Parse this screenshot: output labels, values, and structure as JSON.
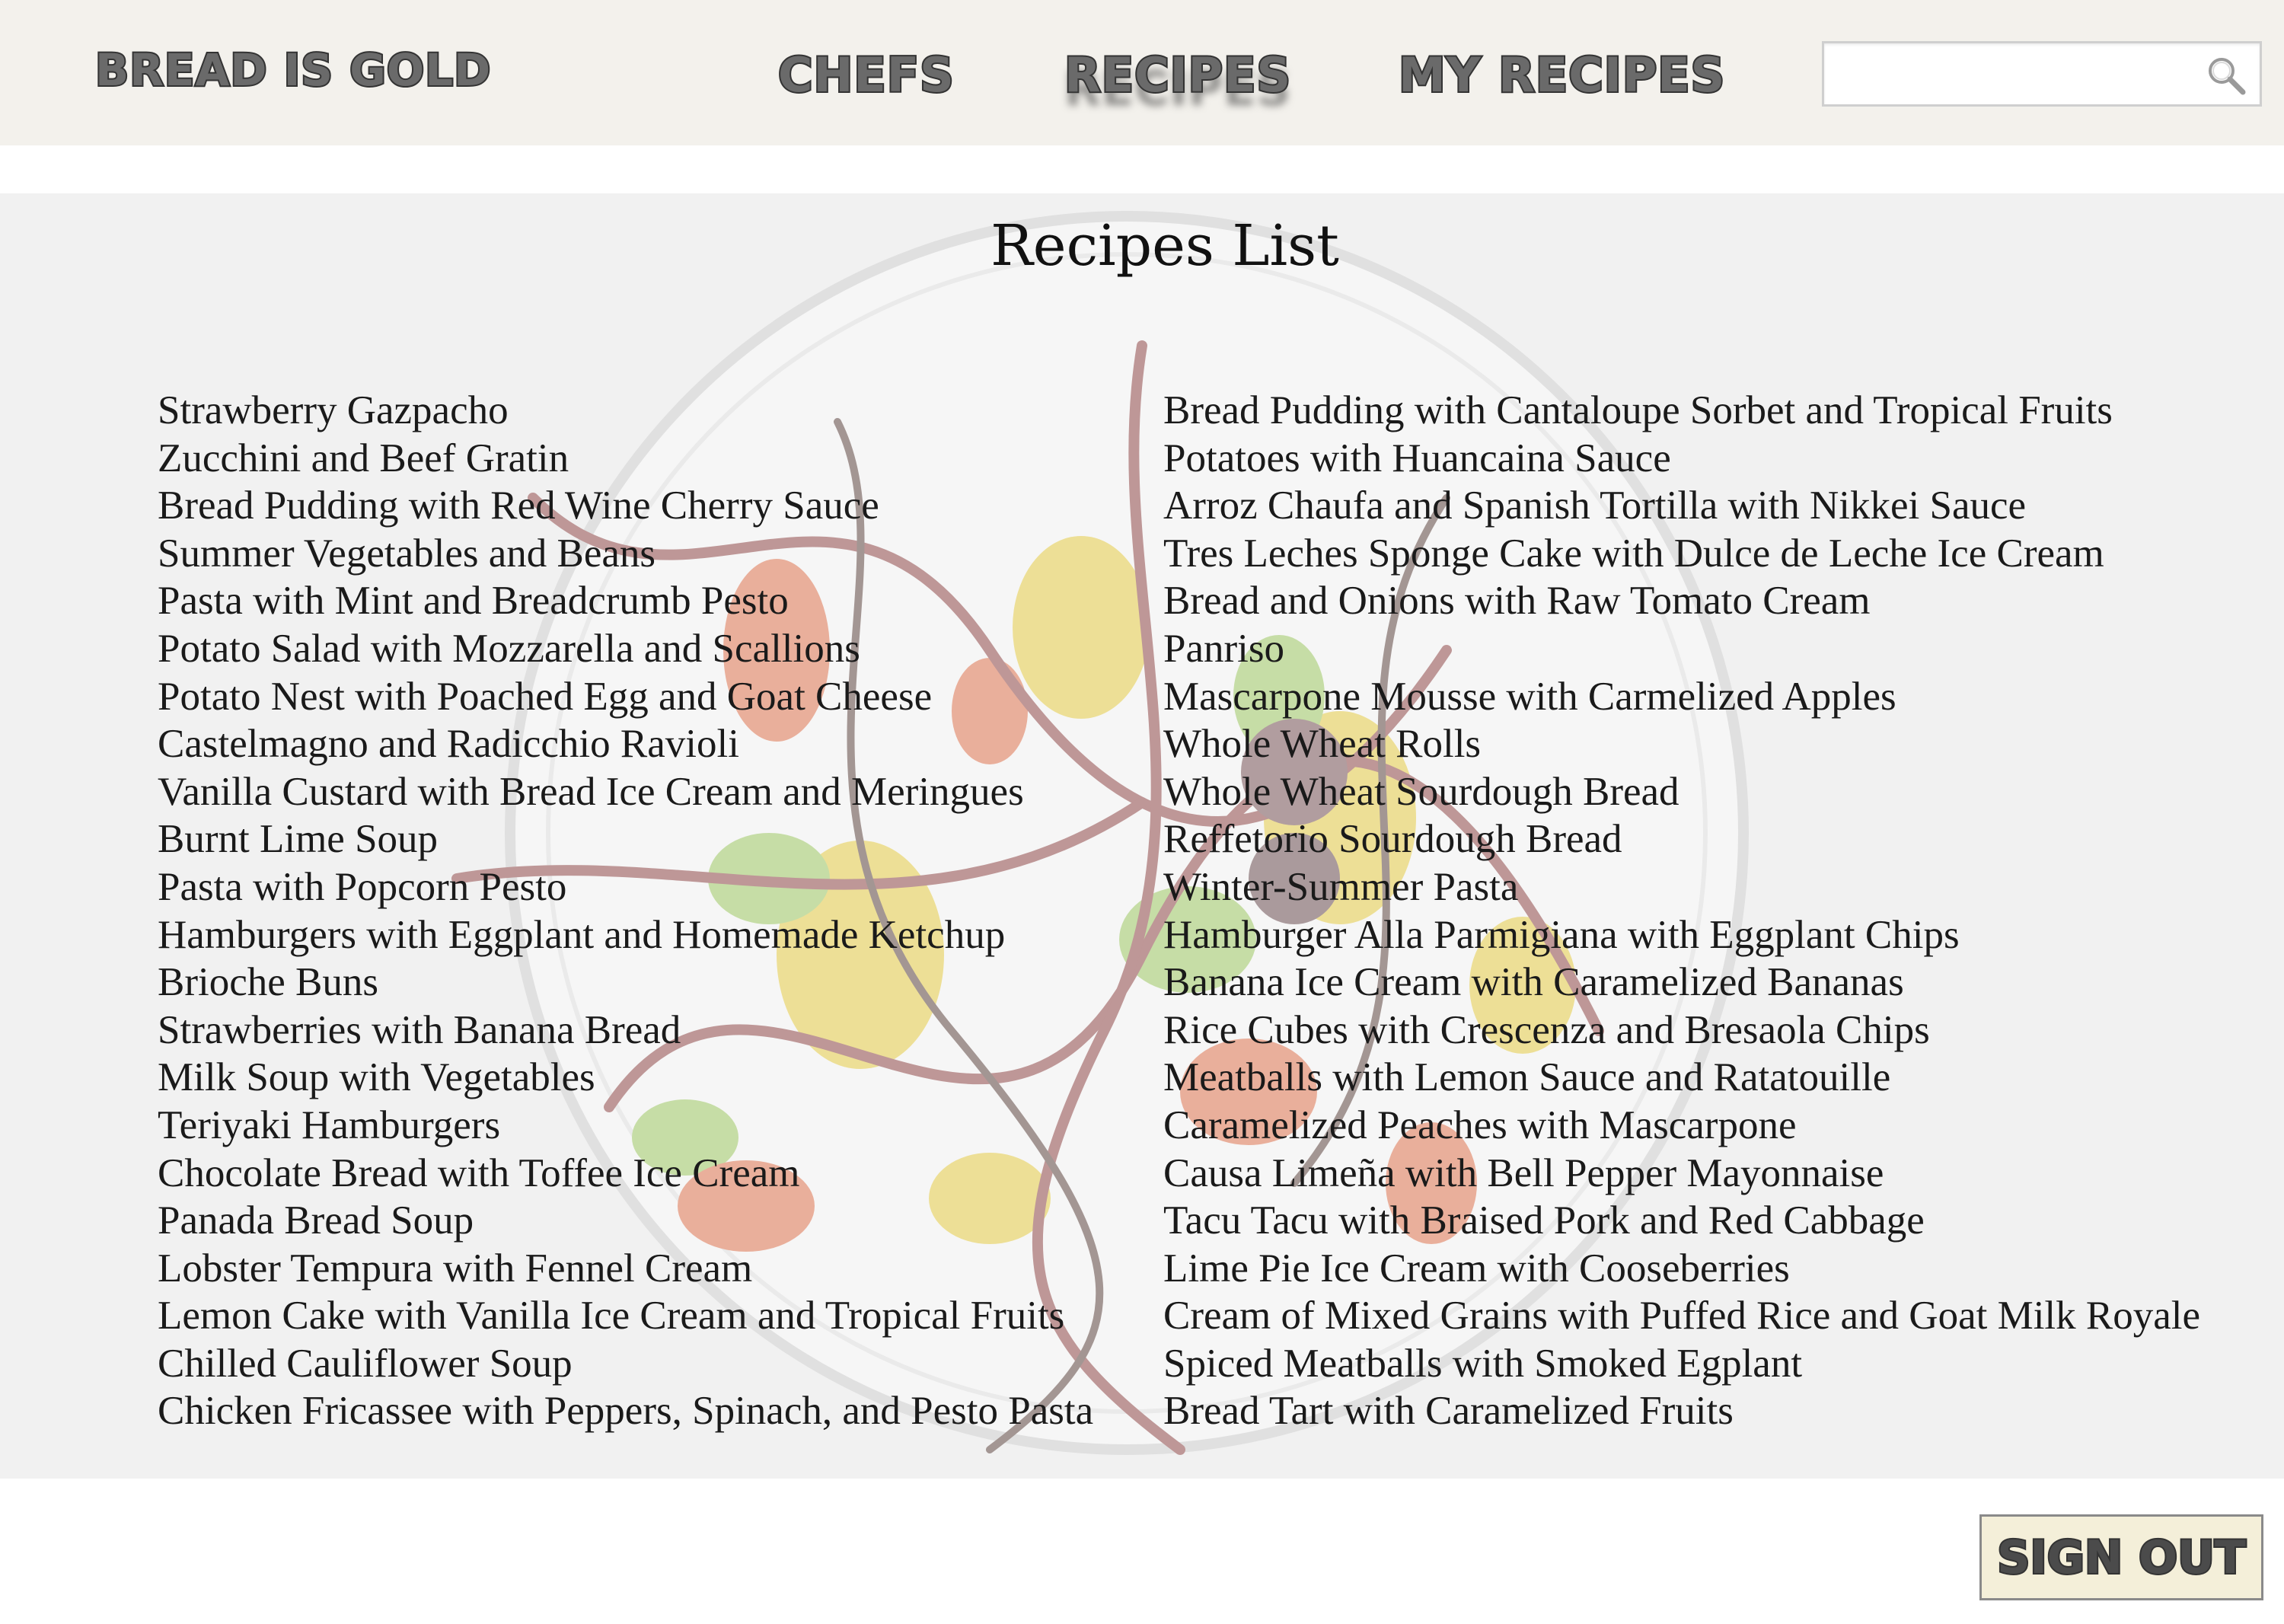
{
  "header": {
    "brand": "Bread is Gold",
    "nav": {
      "chefs": "Chefs",
      "recipes": "Recipes",
      "my_recipes": "My Recipes"
    },
    "search": {
      "value": "",
      "placeholder": "",
      "icon": "search-icon"
    }
  },
  "main": {
    "title": "Recipes List",
    "recipes_left": [
      "Strawberry Gazpacho",
      "Zucchini and Beef Gratin",
      "Bread Pudding with Red Wine Cherry Sauce",
      "Summer Vegetables and Beans",
      "Pasta with Mint and Breadcrumb Pesto",
      "Potato Salad with Mozzarella and Scallions",
      "Potato Nest with Poached Egg and Goat Cheese",
      "Castelmagno and Radicchio Ravioli",
      "Vanilla Custard with Bread Ice Cream and Meringues",
      "Burnt Lime Soup",
      "Pasta with Popcorn Pesto",
      "Hamburgers with Eggplant and Homemade Ketchup",
      "Brioche Buns",
      "Strawberries with Banana Bread",
      "Milk Soup with Vegetables",
      "Teriyaki Hamburgers",
      "Chocolate Bread with Toffee Ice Cream",
      "Panada Bread Soup",
      "Lobster Tempura with Fennel Cream",
      "Lemon Cake with Vanilla Ice Cream and Tropical Fruits",
      "Chilled Cauliflower Soup",
      "Chicken Fricassee with Peppers, Spinach, and Pesto Pasta"
    ],
    "recipes_right": [
      "Bread Pudding with Cantaloupe Sorbet and Tropical Fruits",
      "Potatoes with Huancaina Sauce",
      "Arroz Chaufa and Spanish Tortilla with Nikkei Sauce",
      "Tres Leches Sponge Cake with Dulce de Leche Ice Cream",
      "Bread and Onions with Raw Tomato Cream",
      "Panriso",
      "Mascarpone Mousse with Carmelized Apples",
      "Whole Wheat Rolls",
      "Whole Wheat Sourdough Bread",
      "Reffetorio Sourdough Bread",
      "Winter-Summer Pasta",
      "Hamburger Alla Parmigiana with Eggplant Chips",
      "Banana Ice Cream with Caramelized Bananas",
      "Rice Cubes with Crescenza and Bresaola Chips",
      "Meatballs with Lemon Sauce and Ratatouille",
      "Caramelized Peaches with Mascarpone",
      "Causa Limeña with Bell Pepper Mayonnaise",
      "Tacu Tacu with Braised Pork and Red Cabbage",
      "Lime Pie Ice Cream with Cooseberries",
      "Cream of Mixed Grains with Puffed Rice and Goat Milk Royale",
      "Spiced Meatballs with Smoked Egplant",
      "Bread Tart with Caramelized Fruits"
    ]
  },
  "footer": {
    "sign_out": "Sign Out"
  },
  "colors": {
    "header_bg": "#f3f1ec",
    "panel_bg": "#f1f1f1",
    "nav_text": "#6a6a6a",
    "signout_bg": "#f4efd9"
  }
}
